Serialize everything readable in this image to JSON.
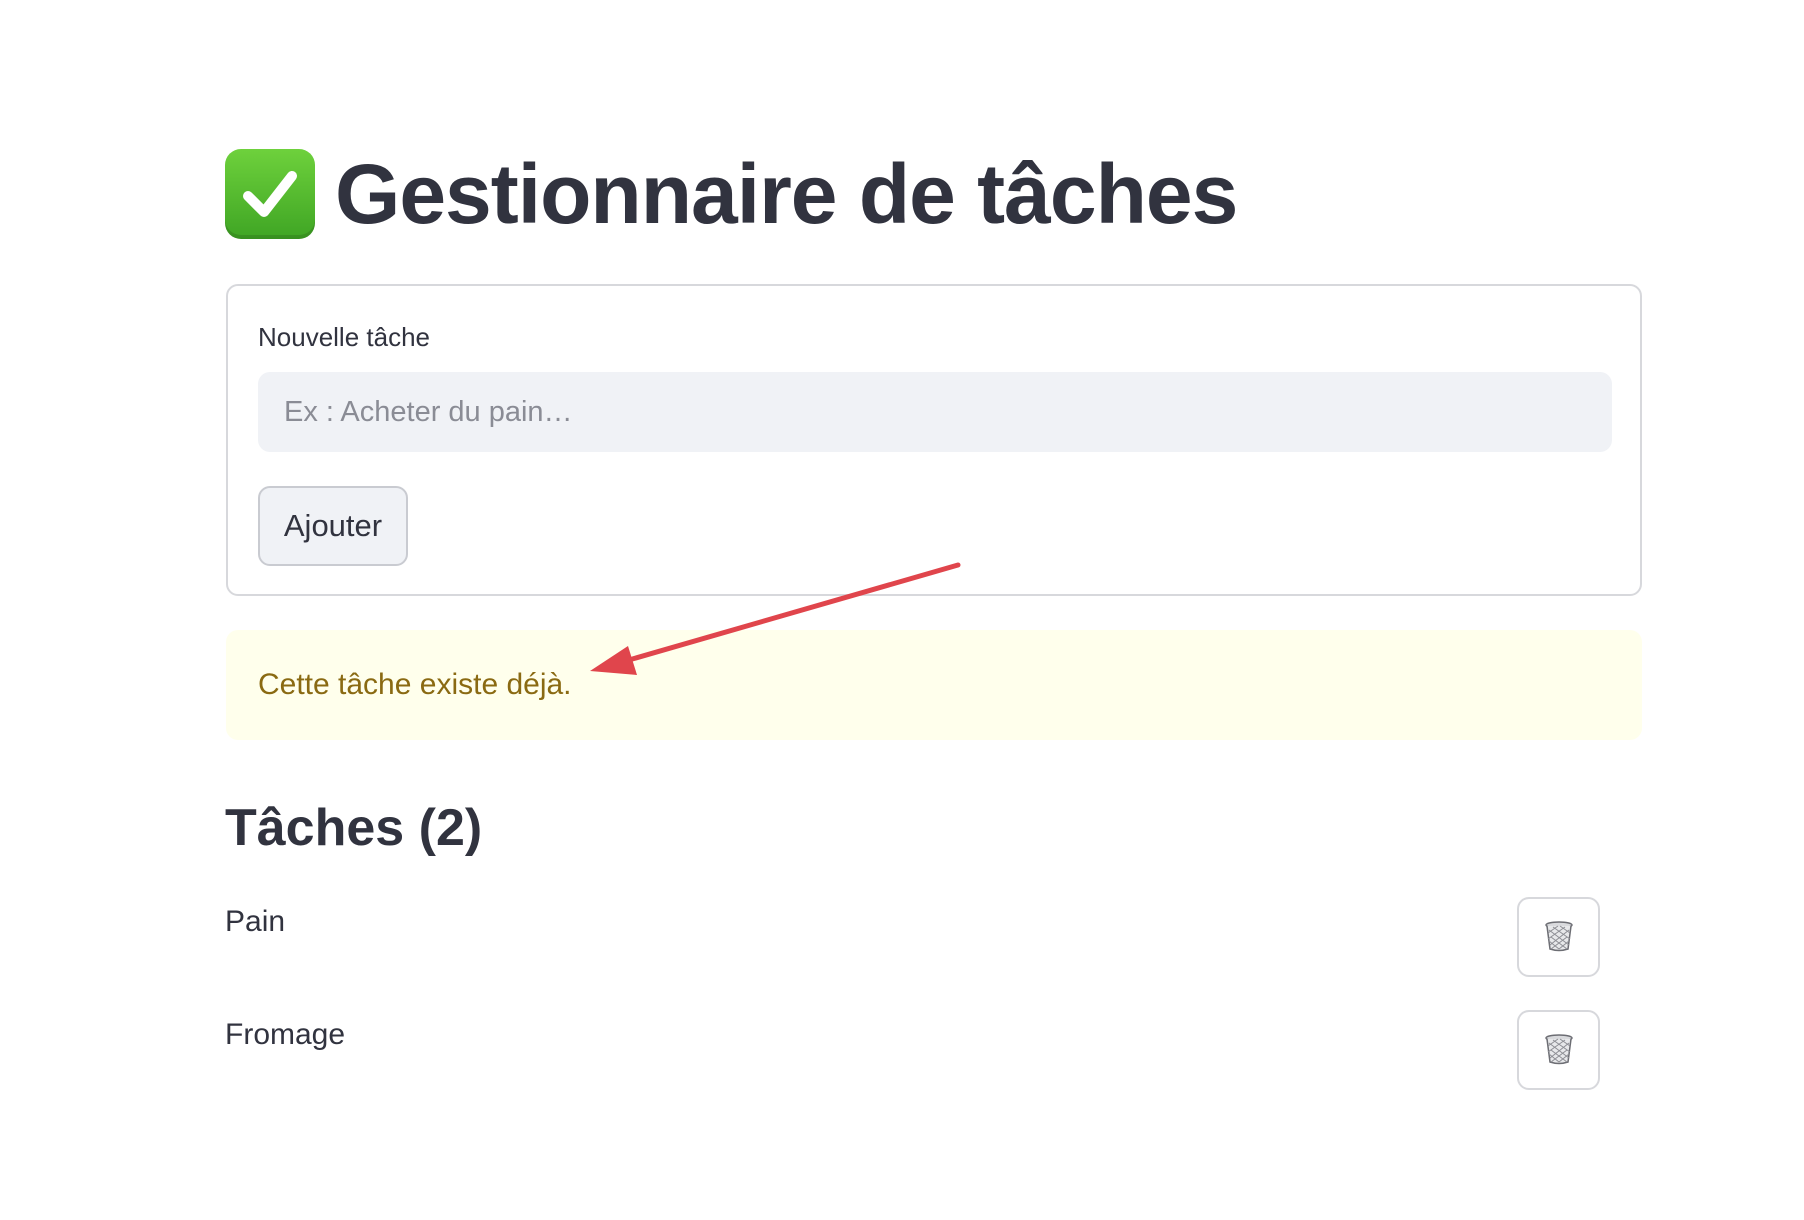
{
  "header": {
    "icon": "check-mark-icon",
    "title": "Gestionnaire de tâches"
  },
  "form": {
    "label": "Nouvelle tâche",
    "input_value": "",
    "input_placeholder": "Ex : Acheter du pain…",
    "submit_label": "Ajouter"
  },
  "alert": {
    "message": "Cette tâche existe déjà.",
    "background": "#ffffec",
    "text_color": "#8a6a12"
  },
  "annotation": {
    "arrow_color": "#e0454c"
  },
  "tasks": {
    "heading": "Tâches (2)",
    "items": [
      {
        "name": "Pain",
        "delete_icon": "trash-icon"
      },
      {
        "name": "Fromage",
        "delete_icon": "trash-icon"
      }
    ]
  },
  "colors": {
    "text": "#31333f",
    "input_bg": "#f0f2f6",
    "border": "#d7d8dc",
    "check_green": "#52bd2e"
  }
}
